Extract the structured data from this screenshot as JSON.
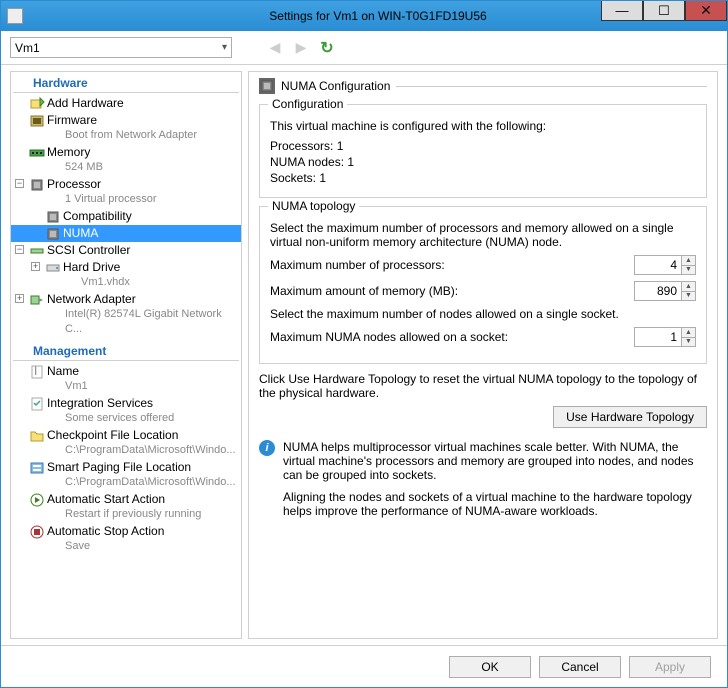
{
  "window": {
    "title": "Settings for Vm1 on WIN-T0G1FD19U56"
  },
  "toolbar": {
    "vm_name": "Vm1"
  },
  "tree": {
    "hardware_header": "Hardware",
    "management_header": "Management",
    "add_hardware": "Add Hardware",
    "firmware": {
      "label": "Firmware",
      "sub": "Boot from Network Adapter"
    },
    "memory": {
      "label": "Memory",
      "sub": "524 MB"
    },
    "processor": {
      "label": "Processor",
      "sub": "1 Virtual processor"
    },
    "compatibility": "Compatibility",
    "numa": "NUMA",
    "scsi": "SCSI Controller",
    "hard_drive": {
      "label": "Hard Drive",
      "sub": "Vm1.vhdx"
    },
    "network_adapter": {
      "label": "Network Adapter",
      "sub": "Intel(R) 82574L Gigabit Network C..."
    },
    "name": {
      "label": "Name",
      "sub": "Vm1"
    },
    "integration": {
      "label": "Integration Services",
      "sub": "Some services offered"
    },
    "checkpoint": {
      "label": "Checkpoint File Location",
      "sub": "C:\\ProgramData\\Microsoft\\Windo..."
    },
    "smart_paging": {
      "label": "Smart Paging File Location",
      "sub": "C:\\ProgramData\\Microsoft\\Windo..."
    },
    "auto_start": {
      "label": "Automatic Start Action",
      "sub": "Restart if previously running"
    },
    "auto_stop": {
      "label": "Automatic Stop Action",
      "sub": "Save"
    }
  },
  "panel": {
    "title": "NUMA Configuration",
    "configuration": {
      "legend": "Configuration",
      "intro": "This virtual machine is configured with the following:",
      "processors_label": "Processors:",
      "processors_value": "1",
      "nodes_label": "NUMA nodes:",
      "nodes_value": "1",
      "sockets_label": "Sockets:",
      "sockets_value": "1"
    },
    "topology": {
      "legend": "NUMA topology",
      "intro": "Select the maximum number of processors and memory allowed on a single virtual non-uniform memory architecture (NUMA) node.",
      "max_proc_label": "Maximum number of processors:",
      "max_proc_value": "4",
      "max_mem_label": "Maximum amount of memory (MB):",
      "max_mem_value": "890",
      "intro2": "Select the maximum number of nodes allowed on a single socket.",
      "max_nodes_label": "Maximum NUMA nodes allowed on a socket:",
      "max_nodes_value": "1"
    },
    "reset_text": "Click Use Hardware Topology to reset the virtual NUMA topology to the topology of the physical hardware.",
    "reset_button": "Use Hardware Topology",
    "info1": "NUMA helps multiprocessor virtual machines scale better.  With NUMA, the virtual machine's processors and memory are grouped into nodes, and nodes can be grouped into sockets.",
    "info2": "Aligning the nodes and sockets of a virtual machine to the hardware topology helps improve the performance of NUMA-aware workloads."
  },
  "footer": {
    "ok": "OK",
    "cancel": "Cancel",
    "apply": "Apply"
  }
}
